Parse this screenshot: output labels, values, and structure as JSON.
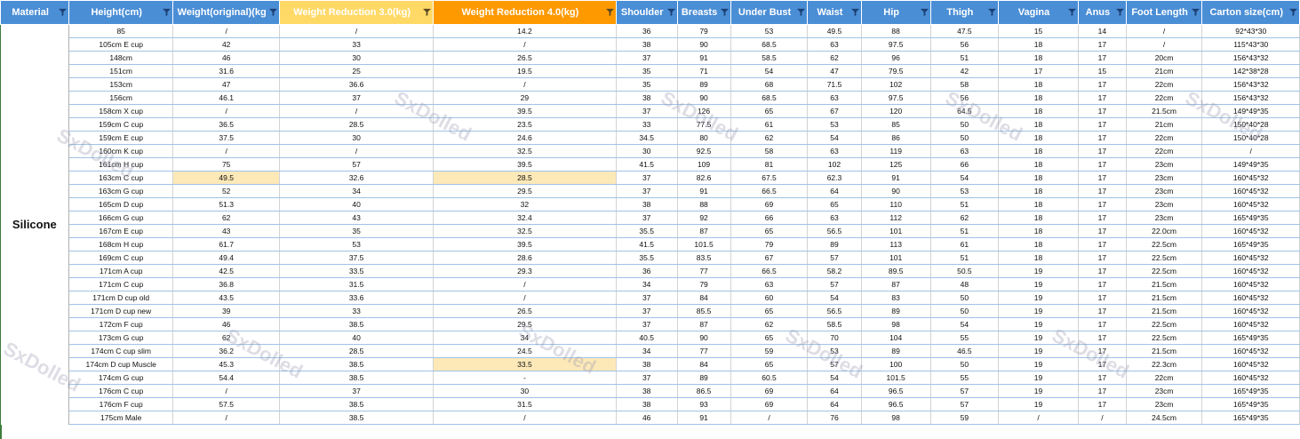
{
  "columns": [
    {
      "label": "Material",
      "width": 72
    },
    {
      "label": "Height(cm)",
      "width": 109
    },
    {
      "label": "Weight(original)(kg",
      "width": 112
    },
    {
      "label": "Weight Reduction 3.0(kg)",
      "width": 161,
      "highlight": "hl3"
    },
    {
      "label": "Weight Reduction 4.0(kg)",
      "width": 192,
      "highlight": "hl4"
    },
    {
      "label": "Shoulder",
      "width": 64
    },
    {
      "label": "Breasts",
      "width": 56
    },
    {
      "label": "Under Bust",
      "width": 81
    },
    {
      "label": "Waist",
      "width": 56
    },
    {
      "label": "Hip",
      "width": 73
    },
    {
      "label": "Thigh",
      "width": 71
    },
    {
      "label": "Vagina",
      "width": 84
    },
    {
      "label": "Anus",
      "width": 50
    },
    {
      "label": "Foot Length",
      "width": 80
    },
    {
      "label": "Carton size(cm)",
      "width": 102
    }
  ],
  "material": "Silicone",
  "watermark": "SxDolled",
  "rows": [
    [
      "85",
      "/",
      "/",
      "14.2",
      "36",
      "79",
      "53",
      "49.5",
      "88",
      "47.5",
      "15",
      "14",
      "/",
      "92*43*30"
    ],
    [
      "105cm E cup",
      "42",
      "33",
      "/",
      "38",
      "90",
      "68.5",
      "63",
      "97.5",
      "56",
      "18",
      "17",
      "/",
      "115*43*30"
    ],
    [
      "148cm",
      "46",
      "30",
      "26.5",
      "37",
      "91",
      "58.5",
      "62",
      "96",
      "51",
      "18",
      "17",
      "20cm",
      "156*43*32"
    ],
    [
      "151cm",
      "31.6",
      "25",
      "19.5",
      "35",
      "71",
      "54",
      "47",
      "79.5",
      "42",
      "17",
      "15",
      "21cm",
      "142*38*28"
    ],
    [
      "153cm",
      "47",
      "36.6",
      "/",
      "35",
      "89",
      "68",
      "71.5",
      "102",
      "58",
      "18",
      "17",
      "22cm",
      "156*43*32"
    ],
    [
      "156cm",
      "46.1",
      "37",
      "29",
      "38",
      "90",
      "68.5",
      "63",
      "97.5",
      "56",
      "18",
      "17",
      "22cm",
      "156*43*32"
    ],
    [
      "158cm X cup",
      "/",
      "/",
      "39.5",
      "37",
      "126",
      "65",
      "67",
      "120",
      "64.5",
      "18",
      "17",
      "21.5cm",
      "149*49*35"
    ],
    [
      "159cm C cup",
      "36.5",
      "28.5",
      "23.5",
      "33",
      "77.5",
      "61",
      "53",
      "85",
      "50",
      "18",
      "17",
      "21cm",
      "150*40*28"
    ],
    [
      "159cm E cup",
      "37.5",
      "30",
      "24.6",
      "34.5",
      "80",
      "62",
      "54",
      "86",
      "50",
      "18",
      "17",
      "22cm",
      "150*40*28"
    ],
    [
      "160cm K cup",
      "/",
      "/",
      "32.5",
      "30",
      "92.5",
      "58",
      "63",
      "119",
      "63",
      "18",
      "17",
      "22cm",
      "/"
    ],
    [
      "161cm H cup",
      "75",
      "57",
      "39.5",
      "41.5",
      "109",
      "81",
      "102",
      "125",
      "66",
      "18",
      "17",
      "23cm",
      "149*49*35"
    ],
    [
      "163cm C cup",
      "49.5",
      "32.6",
      "28.5",
      "37",
      "82.6",
      "67.5",
      "62.3",
      "91",
      "54",
      "18",
      "17",
      "23cm",
      "160*45*32"
    ],
    [
      "163cm G cup",
      "52",
      "34",
      "29.5",
      "37",
      "91",
      "66.5",
      "64",
      "90",
      "53",
      "18",
      "17",
      "23cm",
      "160*45*32"
    ],
    [
      "165cm D cup",
      "51.3",
      "40",
      "32",
      "38",
      "88",
      "69",
      "65",
      "110",
      "51",
      "18",
      "17",
      "23cm",
      "160*45*32"
    ],
    [
      "166cm G cup",
      "62",
      "43",
      "32.4",
      "37",
      "92",
      "66",
      "63",
      "112",
      "62",
      "18",
      "17",
      "23cm",
      "165*49*35"
    ],
    [
      "167cm E cup",
      "43",
      "35",
      "32.5",
      "35.5",
      "87",
      "65",
      "56.5",
      "101",
      "51",
      "18",
      "17",
      "22.0cm",
      "160*45*32"
    ],
    [
      "168cm H cup",
      "61.7",
      "53",
      "39.5",
      "41.5",
      "101.5",
      "79",
      "89",
      "113",
      "61",
      "18",
      "17",
      "22.5cm",
      "165*49*35"
    ],
    [
      "169cm C cup",
      "49.4",
      "37.5",
      "28.6",
      "35.5",
      "83.5",
      "67",
      "57",
      "101",
      "51",
      "18",
      "17",
      "22.5cm",
      "160*45*32"
    ],
    [
      "171cm A cup",
      "42.5",
      "33.5",
      "29.3",
      "36",
      "77",
      "66.5",
      "58.2",
      "89.5",
      "50.5",
      "19",
      "17",
      "22.5cm",
      "160*45*32"
    ],
    [
      "171cm C cup",
      "36.8",
      "31.5",
      "/",
      "34",
      "79",
      "63",
      "57",
      "87",
      "48",
      "19",
      "17",
      "21.5cm",
      "160*45*32"
    ],
    [
      "171cm D cup old",
      "43.5",
      "33.6",
      "/",
      "37",
      "84",
      "60",
      "54",
      "83",
      "50",
      "19",
      "17",
      "21.5cm",
      "160*45*32"
    ],
    [
      "171cm D cup new",
      "39",
      "33",
      "26.5",
      "37",
      "85.5",
      "65",
      "56.5",
      "89",
      "50",
      "19",
      "17",
      "21.5cm",
      "160*45*32"
    ],
    [
      "172cm F cup",
      "46",
      "38.5",
      "29.5",
      "37",
      "87",
      "62",
      "58.5",
      "98",
      "54",
      "19",
      "17",
      "22.5cm",
      "160*45*32"
    ],
    [
      "173cm G cup",
      "62",
      "40",
      "34",
      "40.5",
      "90",
      "65",
      "70",
      "104",
      "55",
      "19",
      "17",
      "22.5cm",
      "165*49*35"
    ],
    [
      "174cm C cup slim",
      "36.2",
      "28.5",
      "24.5",
      "34",
      "77",
      "59",
      "53",
      "89",
      "46.5",
      "19",
      "17",
      "21.5cm",
      "160*45*32"
    ],
    [
      "174cm D cup Muscle",
      "45.3",
      "38.5",
      "33.5",
      "38",
      "84",
      "65",
      "57",
      "100",
      "50",
      "19",
      "17",
      "22.3cm",
      "160*45*32"
    ],
    [
      "174cm G cup",
      "54.4",
      "38.5",
      "-",
      "37",
      "89",
      "60.5",
      "54",
      "101.5",
      "55",
      "19",
      "17",
      "22cm",
      "160*45*32"
    ],
    [
      "176cm C cup",
      "/",
      "37",
      "30",
      "38",
      "86.5",
      "69",
      "64",
      "96.5",
      "57",
      "19",
      "17",
      "23cm",
      "165*49*35"
    ],
    [
      "176cm F cup",
      "57.5",
      "38.5",
      "31.5",
      "38",
      "93",
      "69",
      "64",
      "96.5",
      "57",
      "19",
      "17",
      "23cm",
      "165*49*35"
    ],
    [
      "175cm Male",
      "/",
      "38.5",
      "/",
      "46",
      "91",
      "/",
      "76",
      "98",
      "59",
      "/",
      "/",
      "24.5cm",
      "165*49*35"
    ]
  ],
  "highlight_cells": [
    [
      11,
      1
    ],
    [
      11,
      3
    ],
    [
      25,
      3
    ]
  ],
  "colors": {
    "header_bg": "#4a8ed6",
    "header_hl3": "#ffd966",
    "header_hl4": "#ff9900",
    "cell_highlight": "#fde9b8",
    "row_border": "#9fc3e8"
  },
  "icons": {
    "filter": "filter-dropdown-icon"
  }
}
